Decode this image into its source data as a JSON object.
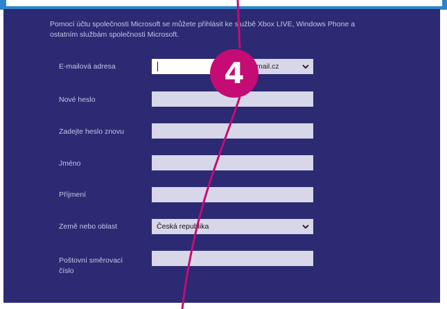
{
  "intro": {
    "line1": "Pomocí účtu společnosti Microsoft se můžete přihlásit ke službě Xbox LIVE, Windows Phone a",
    "line2": "ostatním službám společnosti Microsoft."
  },
  "form": {
    "email_label": "E-mailová adresa",
    "email_value": "",
    "email_domain": "mail.cz",
    "new_password_label": "Nové heslo",
    "confirm_password_label": "Zadejte heslo znovu",
    "first_name_label": "Jméno",
    "last_name_label": "Příjmení",
    "country_label": "Země nebo oblast",
    "country_value": "Česká republika",
    "postal_label_line1": "Poštovní směrovací",
    "postal_label_line2": "číslo"
  },
  "annotation": {
    "step_number": "4"
  },
  "colors": {
    "panel": "#2b2a73",
    "accent_top": "#2e84c8",
    "callout": "#c40c74",
    "field": "#d8d7ea"
  }
}
